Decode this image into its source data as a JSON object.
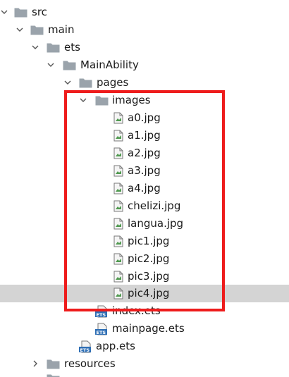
{
  "tree": {
    "highlight_color": "#ee1c1c",
    "selected_bg": "#d4d4d4",
    "folder_color": "#9aa3ab",
    "items": [
      {
        "label": "src",
        "type": "folder",
        "expanded": true
      },
      {
        "label": "main",
        "type": "folder",
        "expanded": true
      },
      {
        "label": "ets",
        "type": "folder",
        "expanded": true
      },
      {
        "label": "MainAbility",
        "type": "folder",
        "expanded": true
      },
      {
        "label": "pages",
        "type": "folder",
        "expanded": true
      },
      {
        "label": "images",
        "type": "folder",
        "expanded": true
      },
      {
        "label": "a0.jpg",
        "type": "image-file"
      },
      {
        "label": "a1.jpg",
        "type": "image-file"
      },
      {
        "label": "a2.jpg",
        "type": "image-file"
      },
      {
        "label": "a3.jpg",
        "type": "image-file"
      },
      {
        "label": "a4.jpg",
        "type": "image-file"
      },
      {
        "label": "chelizi.jpg",
        "type": "image-file"
      },
      {
        "label": "langua.jpg",
        "type": "image-file"
      },
      {
        "label": "pic1.jpg",
        "type": "image-file"
      },
      {
        "label": "pic2.jpg",
        "type": "image-file"
      },
      {
        "label": "pic3.jpg",
        "type": "image-file"
      },
      {
        "label": "pic4.jpg",
        "type": "image-file",
        "selected": true
      },
      {
        "label": "index.ets",
        "type": "ets-file"
      },
      {
        "label": "mainpage.ets",
        "type": "ets-file"
      },
      {
        "label": "app.ets",
        "type": "ets-file"
      },
      {
        "label": "resources",
        "type": "folder",
        "expanded": false
      }
    ]
  }
}
